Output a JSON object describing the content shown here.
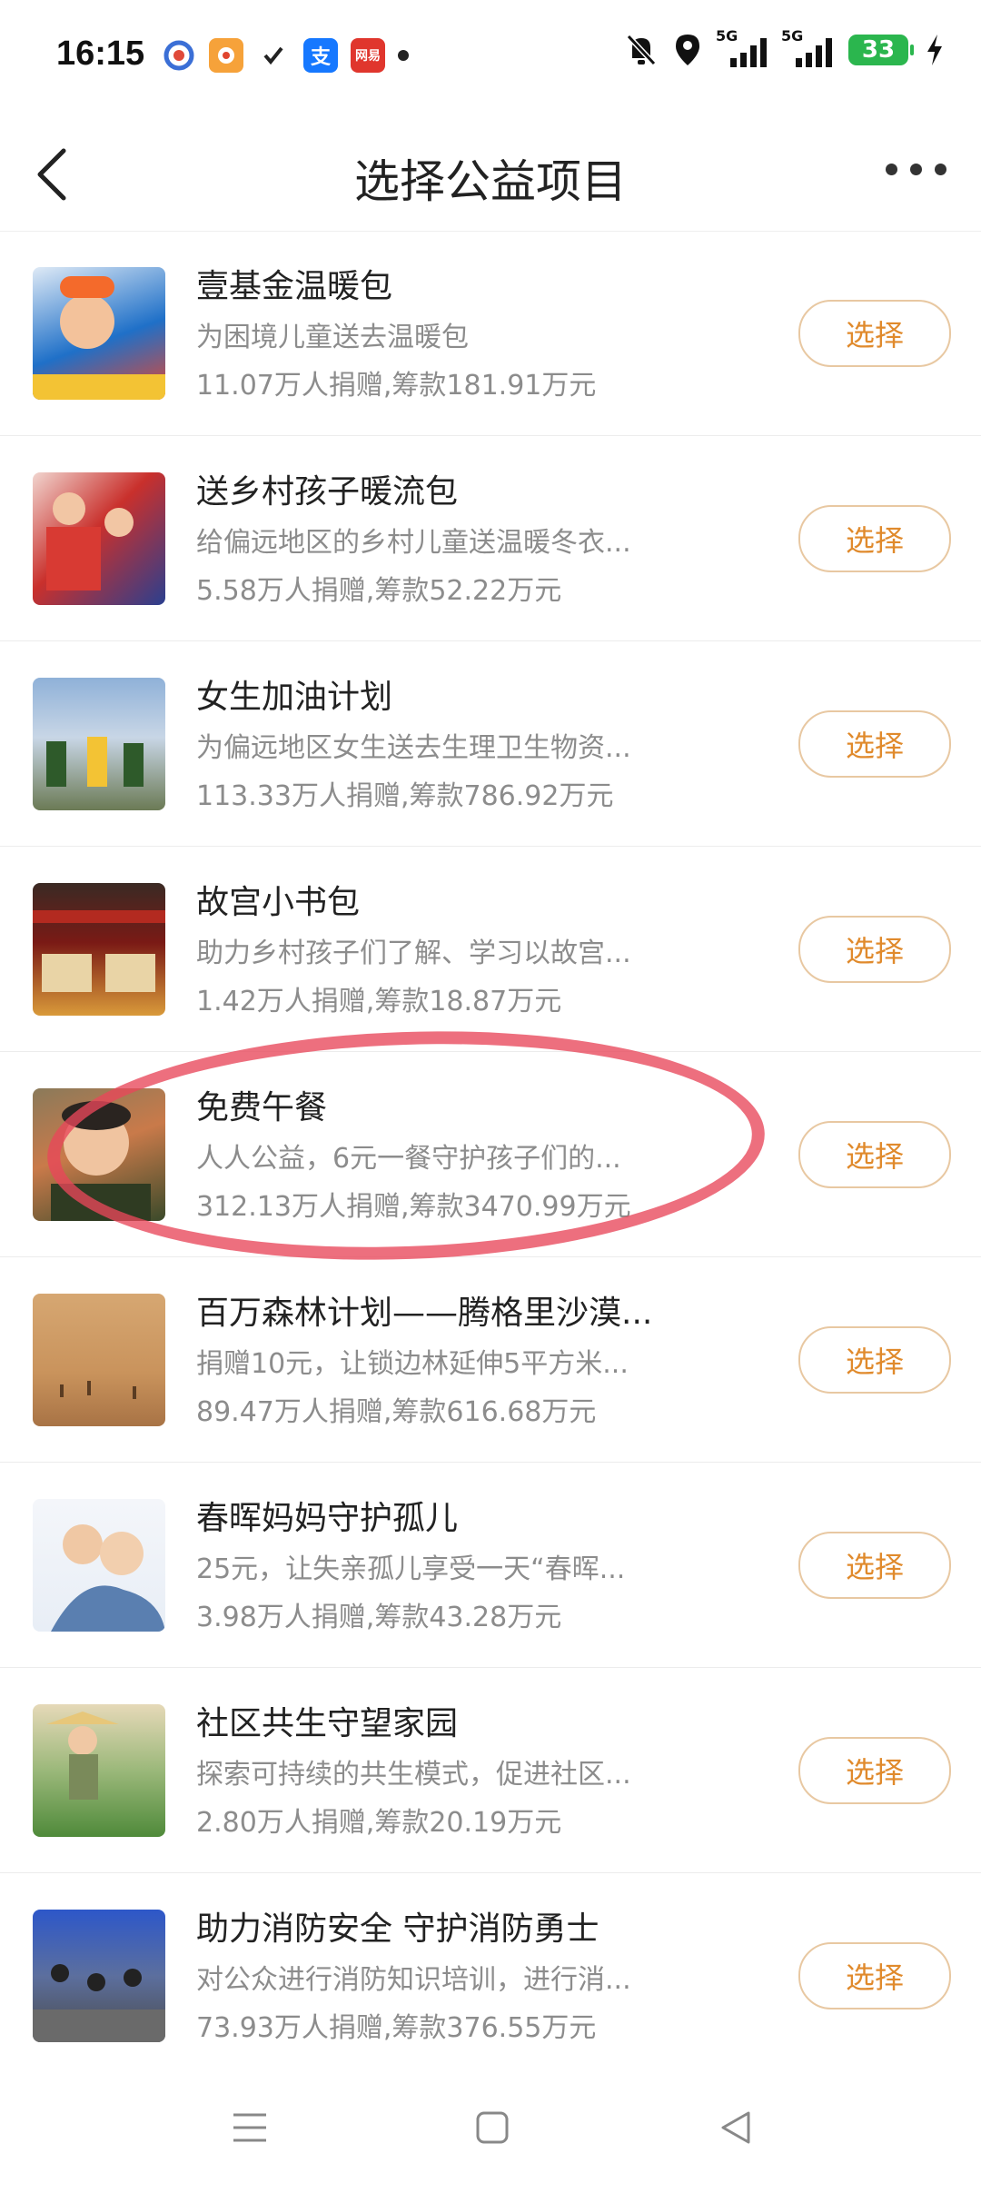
{
  "status_bar": {
    "time": "16:15",
    "app_icons": [
      "app-icon-camera",
      "app-icon-food",
      "check-icon",
      "alipay-icon",
      "netease-icon"
    ],
    "alipay_label": "支",
    "netease_label": "网易",
    "network1": "5G",
    "network2": "5G",
    "battery": "33"
  },
  "nav": {
    "title": "选择公益项目"
  },
  "items": [
    {
      "name": "壹基金温暖包",
      "desc": "为困境儿童送去温暖包",
      "stats": "11.07万人捐赠,筹款181.91万元",
      "button": "选择",
      "thumb_colors": [
        "#1f70c8",
        "#e8452d"
      ]
    },
    {
      "name": "送乡村孩子暖流包",
      "desc": "给偏远地区的乡村儿童送温暖冬衣...",
      "stats": "5.58万人捐赠,筹款52.22万元",
      "button": "选择",
      "thumb_colors": [
        "#c9302c",
        "#2a3f8f"
      ]
    },
    {
      "name": "女生加油计划",
      "desc": "为偏远地区女生送去生理卫生物资...",
      "stats": "113.33万人捐赠,筹款786.92万元",
      "button": "选择",
      "thumb_colors": [
        "#8fb1d8",
        "#2e5a2a"
      ]
    },
    {
      "name": "故宫小书包",
      "desc": "助力乡村孩子们了解、学习以故宫...",
      "stats": "1.42万人捐赠,筹款18.87万元",
      "button": "选择",
      "thumb_colors": [
        "#7a1a15",
        "#d99a3a"
      ]
    },
    {
      "name": "免费午餐",
      "desc": "人人公益，6元一餐守护孩子们的...",
      "stats": "312.13万人捐赠,筹款3470.99万元",
      "button": "选择",
      "thumb_colors": [
        "#3a4a2a",
        "#c97a4a"
      ]
    },
    {
      "name": "百万森林计划——腾格里沙漠...",
      "desc": "捐赠10元，让锁边林延伸5平方米...",
      "stats": "89.47万人捐赠,筹款616.68万元",
      "button": "选择",
      "thumb_colors": [
        "#d6a772",
        "#a87345"
      ]
    },
    {
      "name": "春晖妈妈守护孤儿",
      "desc": "25元，让失亲孤儿享受一天“春晖...",
      "stats": "3.98万人捐赠,筹款43.28万元",
      "button": "选择",
      "thumb_colors": [
        "#e8eef6",
        "#5a7fb0"
      ]
    },
    {
      "name": "社区共生守望家园",
      "desc": "探索可持续的共生模式，促进社区...",
      "stats": "2.80万人捐赠,筹款20.19万元",
      "button": "选择",
      "thumb_colors": [
        "#4f8a3a",
        "#e6d9b8"
      ]
    },
    {
      "name": "助力消防安全 守护消防勇士",
      "desc": "对公众进行消防知识培训，进行消...",
      "stats": "73.93万人捐赠,筹款376.55万元",
      "button": "选择",
      "thumb_colors": [
        "#2d57c9",
        "#4a4a4a"
      ]
    }
  ],
  "bottom_nav": [
    "menu-icon",
    "home-icon",
    "back-triangle-icon"
  ]
}
